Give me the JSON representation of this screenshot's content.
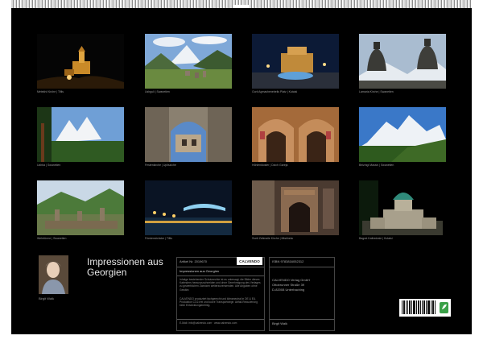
{
  "calendar": {
    "title": "Impressionen aus Georgien",
    "author": "Birgit Walk",
    "article_no": "Artikel Nr. 2019670",
    "isbn": "ISBN 9783816052312",
    "brand": "CALVENDO",
    "publisher_lines": [
      "CALVENDO Verlag GmbH",
      "Ottobrunner Straße 39",
      "D-82008 Unterhaching"
    ],
    "info_title": "Impressionen aus Georgien",
    "info_paragraph1": "Inhalge bestehender Schutzrechte ist es untersagt, die Bilder dieses Kalenders herauszuschneiden und ohne Genehmigung des Verlages zu gewerblichen Zwecken weiterzuverwenden. Alle Angaben ohne Gewähr.",
    "info_paragraph2": "CALVENDO produziert fachgerecht und klimaneutral in DE & EU. Produktion CO2-frei und kurze Transportwege. Abfall-Reduzierung beim Entwicklungsbetrieg.",
    "email": "E-Mail: info@calvendo.com · www.calvendo.com",
    "author_label": "Birgit Walk"
  },
  "photos": [
    {
      "caption": "Metekhi Kirche | Tiflis"
    },
    {
      "caption": "Ushguli | Swanetien"
    },
    {
      "caption": "Gorii Agmashenebelis Platz | Kutaisi"
    },
    {
      "caption": "Lamaria Kirche | Swanetien"
    },
    {
      "caption": "Ushba | Swanetien"
    },
    {
      "caption": "Festenkirche | Uplisziche"
    },
    {
      "caption": "Höhlenkloster | Dzich Gareja"
    },
    {
      "caption": "Beizingi Massiv | Swanetien"
    },
    {
      "caption": "Wehrtürme | Swanetien"
    },
    {
      "caption": "Friedensbrücke | Tiflis"
    },
    {
      "caption": "Sveti Zelimaile Kirche | Mtskheta"
    },
    {
      "caption": "Bagrat Kathedrale | Kutaisi"
    }
  ]
}
